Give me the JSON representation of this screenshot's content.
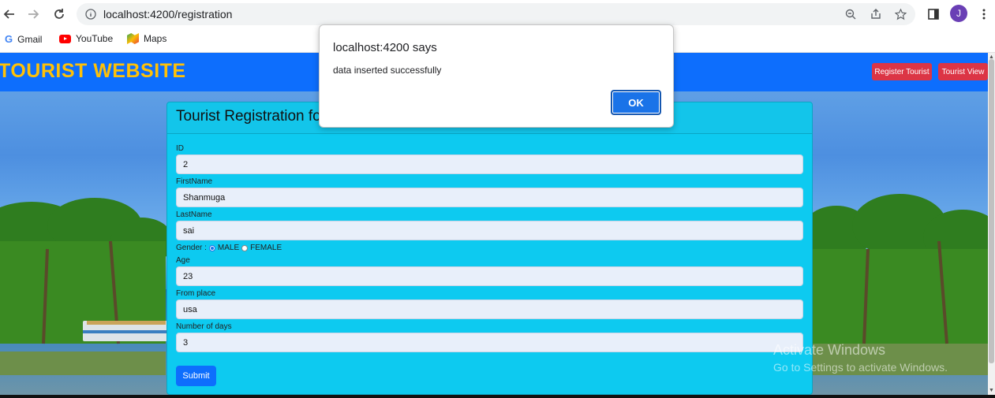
{
  "browser": {
    "url": "localhost:4200/registration",
    "avatar_letter": "J",
    "bookmarks": [
      {
        "label": "Gmail",
        "icon": "google-icon"
      },
      {
        "label": "YouTube",
        "icon": "youtube-icon"
      },
      {
        "label": "Maps",
        "icon": "maps-icon"
      }
    ]
  },
  "navbar": {
    "brand": "TOURIST WEBSITE",
    "register_label": "Register Tourist",
    "view_label": "Tourist View",
    "brand_color": "#ffc107",
    "bar_color": "#0d6efd",
    "button_color": "#dc3545"
  },
  "form": {
    "title": "Tourist Registration fo",
    "fields": {
      "id": {
        "label": "ID",
        "value": "2"
      },
      "first_name": {
        "label": "FirstName",
        "value": "Shanmuga"
      },
      "last_name": {
        "label": "LastName",
        "value": "sai"
      },
      "age": {
        "label": "Age",
        "value": "23"
      },
      "from_place": {
        "label": "From place",
        "value": "usa"
      },
      "days": {
        "label": "Number of days",
        "value": "3"
      }
    },
    "gender": {
      "label": "Gender :",
      "male": "MALE",
      "female": "FEMALE",
      "selected": "MALE"
    },
    "submit_label": "Submit"
  },
  "dialog": {
    "title": "localhost:4200 says",
    "message": "data inserted successfully",
    "ok_label": "OK"
  },
  "watermark": {
    "line1": "Activate Windows",
    "line2": "Go to Settings to activate Windows."
  }
}
